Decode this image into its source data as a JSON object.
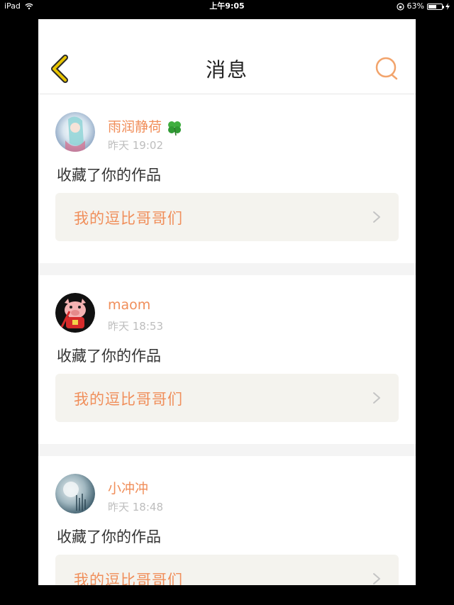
{
  "status_bar": {
    "device": "iPad",
    "time": "上午9:05",
    "battery": "63%",
    "battery_level": 0.63
  },
  "nav": {
    "title": "消息"
  },
  "messages": [
    {
      "user_name": "雨润静荷",
      "time": "昨天 19:02",
      "action": "收藏了你的作品",
      "work_title": "我的逗比哥哥们"
    },
    {
      "user_name": "maom",
      "time": "昨天 18:53",
      "action": "收藏了你的作品",
      "work_title": "我的逗比哥哥们"
    },
    {
      "user_name": "小冲冲",
      "time": "昨天 18:48",
      "action": "收藏了你的作品",
      "work_title": "我的逗比哥哥们"
    }
  ],
  "colors": {
    "accent": "#f08e5a",
    "back_icon": "#e8c400",
    "card_bg": "#f4f3ee",
    "time_text": "#bdbdbd"
  },
  "icons": {
    "back": "chevron-left-icon",
    "search": "search-icon",
    "card_arrow": "chevron-right-icon",
    "name_badge": "clover-icon"
  }
}
